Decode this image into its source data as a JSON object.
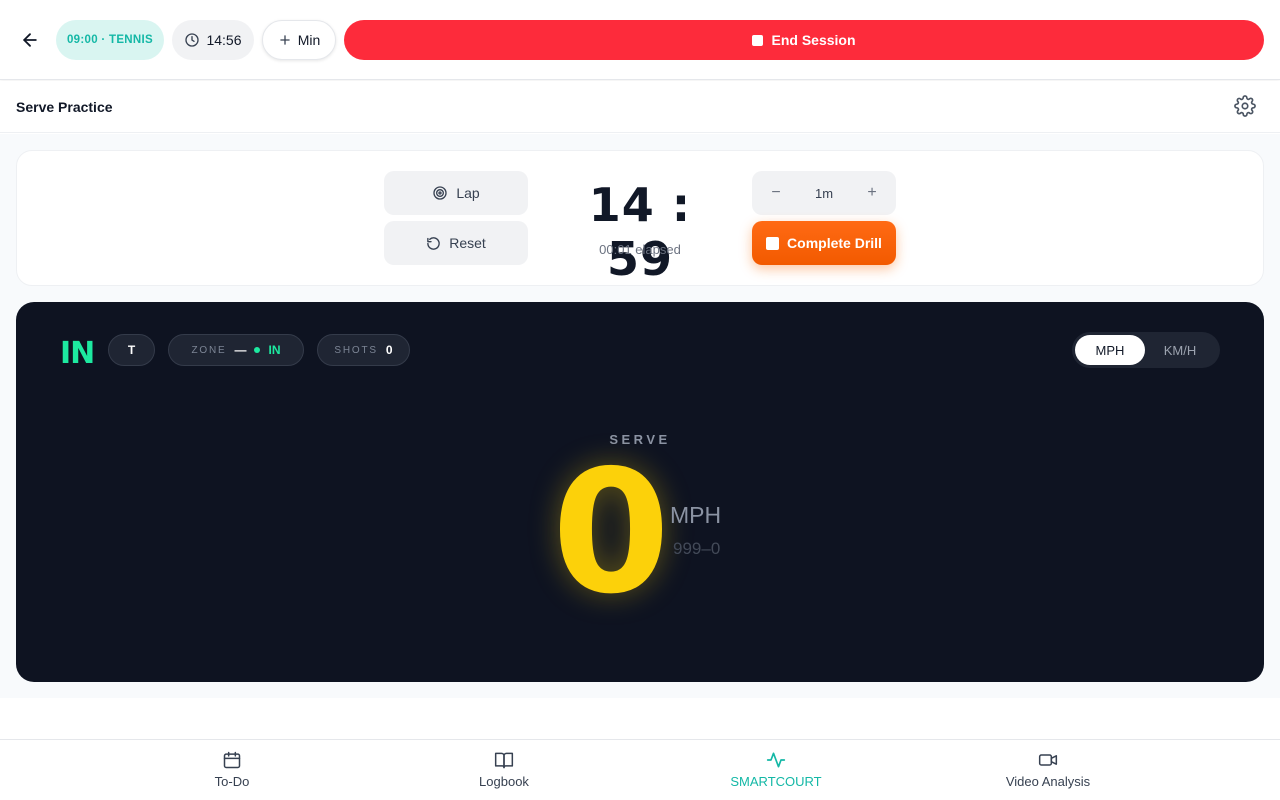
{
  "topbar": {
    "session_label": "09:00 · TENNIS",
    "clock_time": "14:56",
    "add_min_label": "Min",
    "end_session_label": "End Session",
    "accent_color": "#fd2b3b"
  },
  "page": {
    "title": "Serve Practice"
  },
  "timer": {
    "lap_label": "Lap",
    "reset_label": "Reset",
    "time_left": "14 : 59",
    "elapsed": "00:01 elapsed",
    "step_value": "1m",
    "complete_label": "Complete Drill",
    "complete_color": "#f97316"
  },
  "stats": {
    "logo": "IN",
    "type_chip": "T",
    "zone_label": "ZONE",
    "zone_value": "—",
    "zone_status": "IN",
    "shots_label": "SHOTS",
    "shots_value": "0",
    "units": [
      "MPH",
      "KM/H"
    ],
    "active_unit": "MPH"
  },
  "speed": {
    "label": "SERVE",
    "value": "0",
    "unit": "MPH",
    "range": "999–0",
    "color": "#fcd10a"
  },
  "nav": {
    "items": [
      {
        "label": "To-Do",
        "icon": "calendar-icon"
      },
      {
        "label": "Logbook",
        "icon": "book-icon"
      },
      {
        "label": "SMARTCOURT",
        "icon": "activity-icon"
      },
      {
        "label": "Video Analysis",
        "icon": "video-icon"
      }
    ],
    "active_index": 2,
    "active_color": "#14b8a6"
  }
}
